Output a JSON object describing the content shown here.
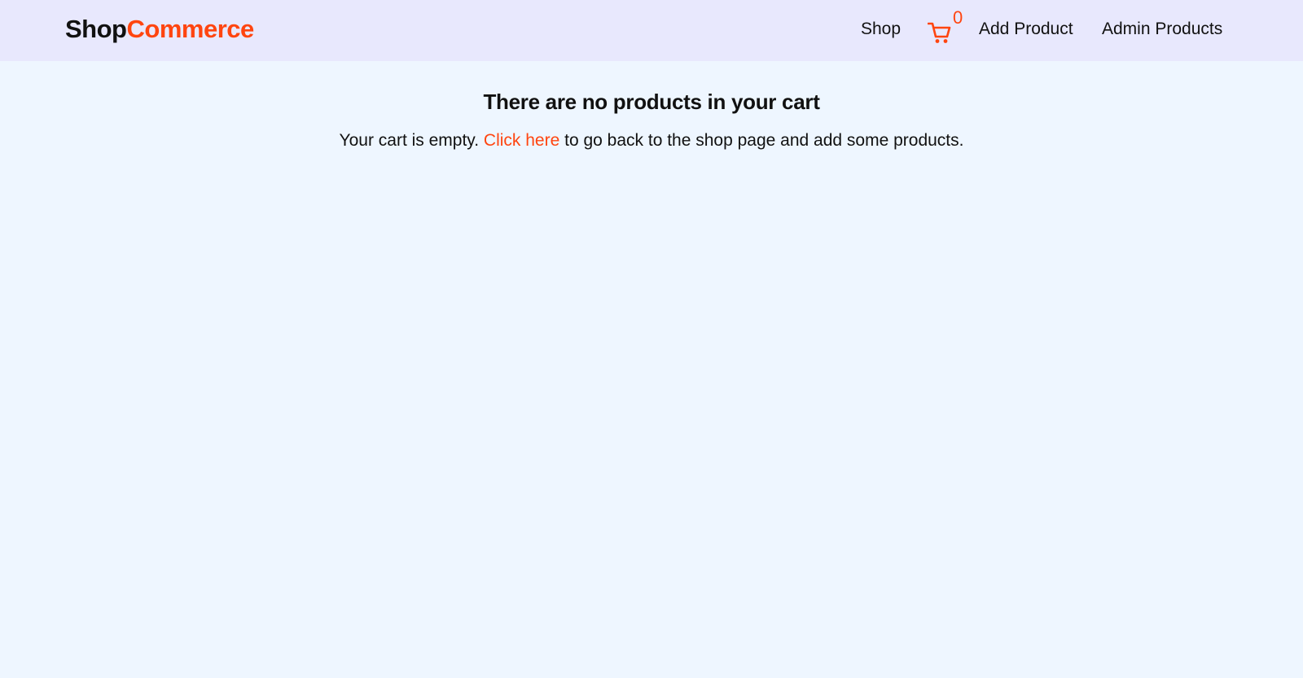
{
  "brand": {
    "part1": "Shop",
    "part2": "Commerce"
  },
  "nav": {
    "shop_label": "Shop",
    "cart_count": "0",
    "add_product_label": "Add Product",
    "admin_products_label": "Admin Products"
  },
  "icons": {
    "cart": "shopping-cart-icon"
  },
  "cart_page": {
    "heading": "There are no products in your cart",
    "message_prefix": "Your cart is empty. ",
    "link_text": "Click here",
    "message_suffix": " to go back to the shop page and add some products."
  },
  "colors": {
    "accent": "#ff4510",
    "navbar_bg": "#e8e8fd",
    "page_bg": "#eef6ff",
    "text": "#111111"
  }
}
